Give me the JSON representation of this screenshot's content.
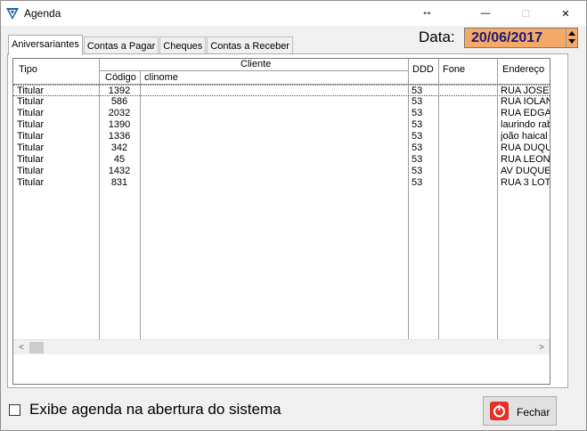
{
  "window": {
    "title": "Agenda",
    "resize_glyph": "↔",
    "minimize_glyph": "—",
    "maximize_glyph": "☐",
    "close_glyph": "✕"
  },
  "tabs": [
    {
      "label": "Aniversariantes",
      "active": true
    },
    {
      "label": "Contas a Pagar"
    },
    {
      "label": "Cheques"
    },
    {
      "label": "Contas a Receber"
    }
  ],
  "date": {
    "label": "Data:",
    "value": "20/06/2017",
    "accent": "#f6a866"
  },
  "grid": {
    "headers": {
      "tipo": "Tipo",
      "cliente": "Cliente",
      "codigo": "Código",
      "clinome": "clinome",
      "ddd": "DDD",
      "fone": "Fone",
      "endereco": "Endereço"
    },
    "rows": [
      {
        "tipo": "Titular",
        "codigo": "1392",
        "ddd": "53",
        "endereco": "RUA JOSE"
      },
      {
        "tipo": "Titular",
        "codigo": "586",
        "ddd": "53",
        "endereco": "RUA IOLAN"
      },
      {
        "tipo": "Titular",
        "codigo": "2032",
        "ddd": "53",
        "endereco": "RUA EDGA"
      },
      {
        "tipo": "Titular",
        "codigo": "1390",
        "ddd": "53",
        "endereco": "laurindo rab"
      },
      {
        "tipo": "Titular",
        "codigo": "1336",
        "ddd": "53",
        "endereco": "joão haical"
      },
      {
        "tipo": "Titular",
        "codigo": "342",
        "ddd": "53",
        "endereco": "RUA DUQU"
      },
      {
        "tipo": "Titular",
        "codigo": "45",
        "ddd": "53",
        "endereco": "RUA LEON"
      },
      {
        "tipo": "Titular",
        "codigo": "1432",
        "ddd": "53",
        "endereco": "AV DUQUE"
      },
      {
        "tipo": "Titular",
        "codigo": "831",
        "ddd": "53",
        "endereco": "RUA 3 LOT"
      }
    ],
    "scroll_left_glyph": "<",
    "scroll_right_glyph": ">"
  },
  "footer": {
    "checkbox_label": "Exibe agenda na abertura do sistema",
    "checkbox_checked": false,
    "close_button_label": "Fechar",
    "close_button_icon": "power-icon"
  }
}
